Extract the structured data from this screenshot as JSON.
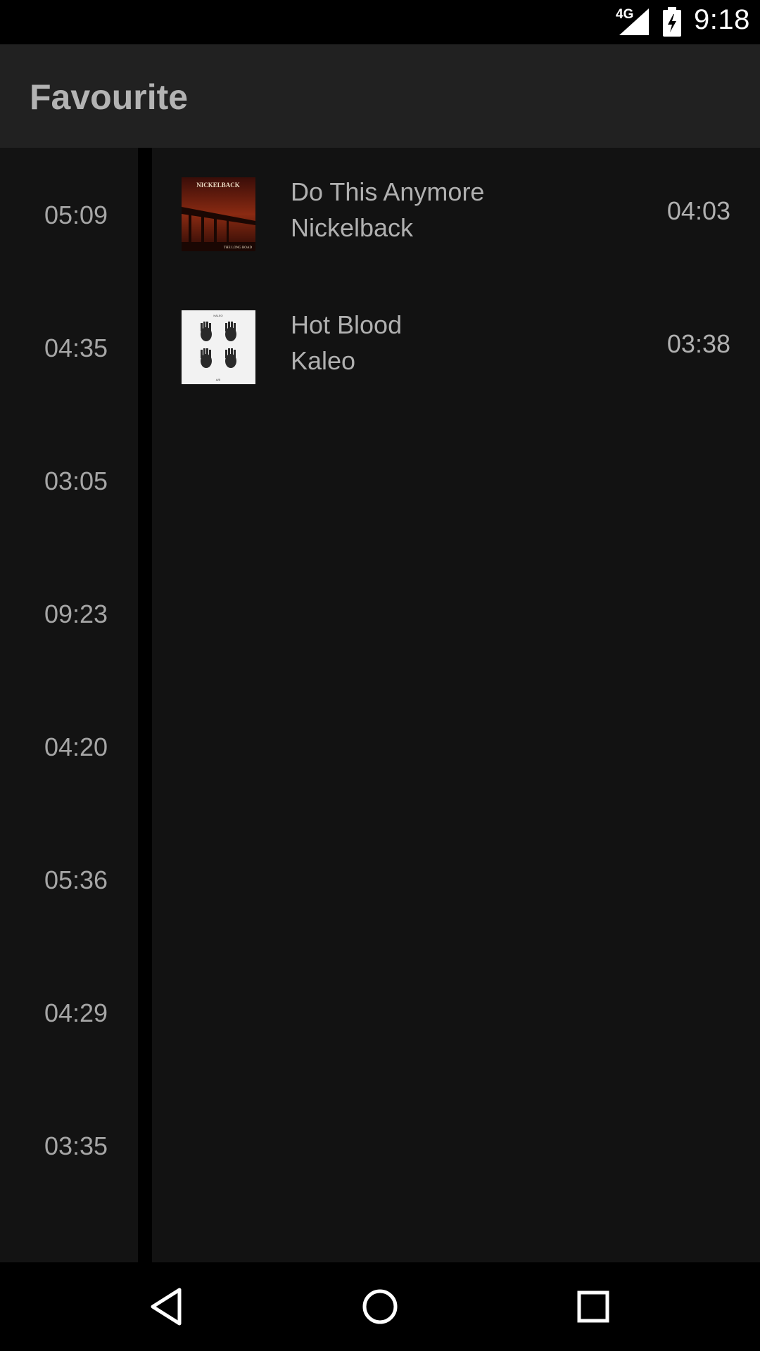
{
  "status_bar": {
    "network": "4G",
    "time": "9:18"
  },
  "app_bar": {
    "title": "Favourite"
  },
  "time_rail": {
    "times": [
      "05:09",
      "04:35",
      "03:05",
      "09:23",
      "04:20",
      "05:36",
      "04:29",
      "03:35"
    ]
  },
  "tracks": [
    {
      "title": "Do This Anymore",
      "artist": "Nickelback",
      "duration": "04:03",
      "album_text_top": "NICKELBACK",
      "album_text_bottom": "THE LONG ROAD"
    },
    {
      "title": "Hot Blood",
      "artist": "Kaleo",
      "duration": "03:38",
      "album_text_top": "KALEO",
      "album_text_bottom": "A/B"
    }
  ],
  "nav": {
    "back": "back-icon",
    "home": "home-icon",
    "recents": "recents-icon"
  }
}
